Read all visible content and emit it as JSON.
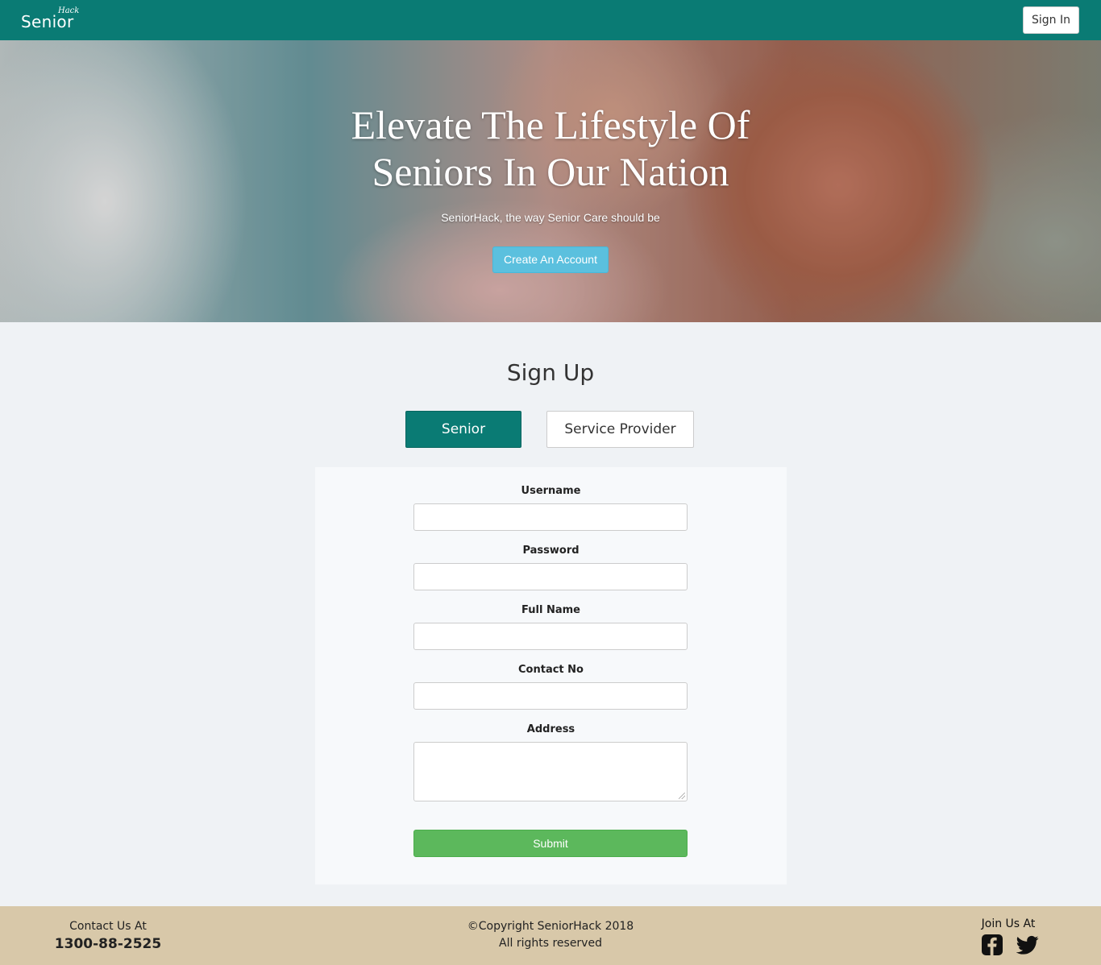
{
  "navbar": {
    "logo_main": "Senior",
    "logo_sup": "Hack",
    "signin_label": "Sign In",
    "bg_color": "#0a7b74"
  },
  "hero": {
    "title_line1": "Elevate The Lifestyle Of",
    "title_line2": "Seniors In Our Nation",
    "subtitle": "SeniorHack, the way Senior Care should be",
    "cta_label": "Create An Account"
  },
  "signup": {
    "title": "Sign Up",
    "roles": [
      {
        "label": "Senior",
        "active": true
      },
      {
        "label": "Service Provider",
        "active": false
      }
    ],
    "fields": [
      {
        "label": "Username",
        "value": "",
        "type": "text"
      },
      {
        "label": "Password",
        "value": "",
        "type": "password"
      },
      {
        "label": "Full Name",
        "value": "",
        "type": "text"
      },
      {
        "label": "Contact No",
        "value": "",
        "type": "text"
      },
      {
        "label": "Address",
        "value": "",
        "type": "textarea"
      }
    ],
    "submit_label": "Submit"
  },
  "footer": {
    "contact_label": "Contact Us At",
    "contact_phone": "1300-88-2525",
    "copyright": "©Copyright SeniorHack 2018",
    "rights": "All rights reserved",
    "join_label": "Join Us At",
    "social_icons": [
      "facebook-icon",
      "twitter-icon"
    ]
  },
  "colors": {
    "primary": "#0a7b74",
    "info": "#5bc0de",
    "success": "#5cb85c",
    "footer_bg": "#d8c8a9",
    "page_bg": "#eff2f5"
  }
}
